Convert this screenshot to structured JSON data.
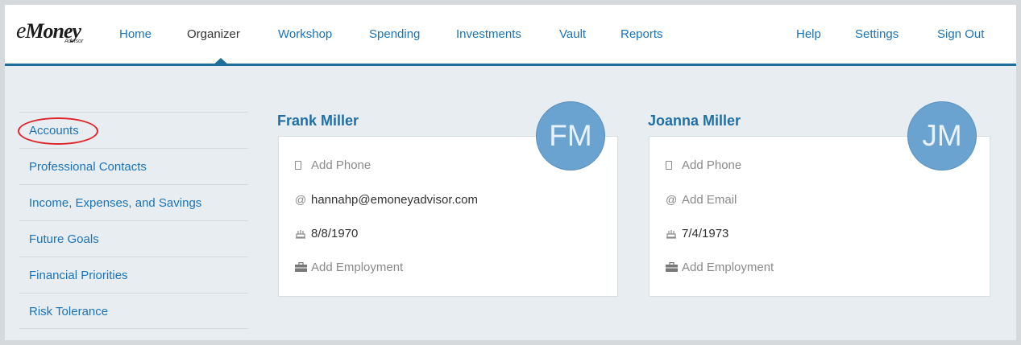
{
  "brand": {
    "logo_text": "Money",
    "logo_prefix": "e",
    "logo_sub": "Advisor"
  },
  "nav": {
    "left": [
      {
        "label": "Home",
        "active": false
      },
      {
        "label": "Organizer",
        "active": true
      },
      {
        "label": "Workshop",
        "active": false
      },
      {
        "label": "Spending",
        "active": false
      },
      {
        "label": "Investments",
        "active": false
      },
      {
        "label": "Vault",
        "active": false
      },
      {
        "label": "Reports",
        "active": false
      }
    ],
    "right": [
      {
        "label": "Help"
      },
      {
        "label": "Settings"
      },
      {
        "label": "Sign Out"
      }
    ]
  },
  "sidebar": {
    "items": [
      {
        "label": "Accounts",
        "highlighted": true
      },
      {
        "label": "Professional Contacts"
      },
      {
        "label": "Income, Expenses, and Savings"
      },
      {
        "label": "Future Goals"
      },
      {
        "label": "Financial Priorities"
      },
      {
        "label": "Risk Tolerance"
      }
    ]
  },
  "people": [
    {
      "name": "Frank Miller",
      "initials": "FM",
      "phone": "Add Phone",
      "email": "hannahp@emoneyadvisor.com",
      "birthdate": "8/8/1970",
      "employment": "Add Employment"
    },
    {
      "name": "Joanna Miller",
      "initials": "JM",
      "phone": "Add Phone",
      "email": "Add Email",
      "birthdate": "7/4/1973",
      "employment": "Add Employment"
    }
  ],
  "colors": {
    "accent": "#1a73b9",
    "nav_border": "#1d6f9c",
    "avatar": "#6aa3d0",
    "highlight_circle": "#e0242a"
  }
}
